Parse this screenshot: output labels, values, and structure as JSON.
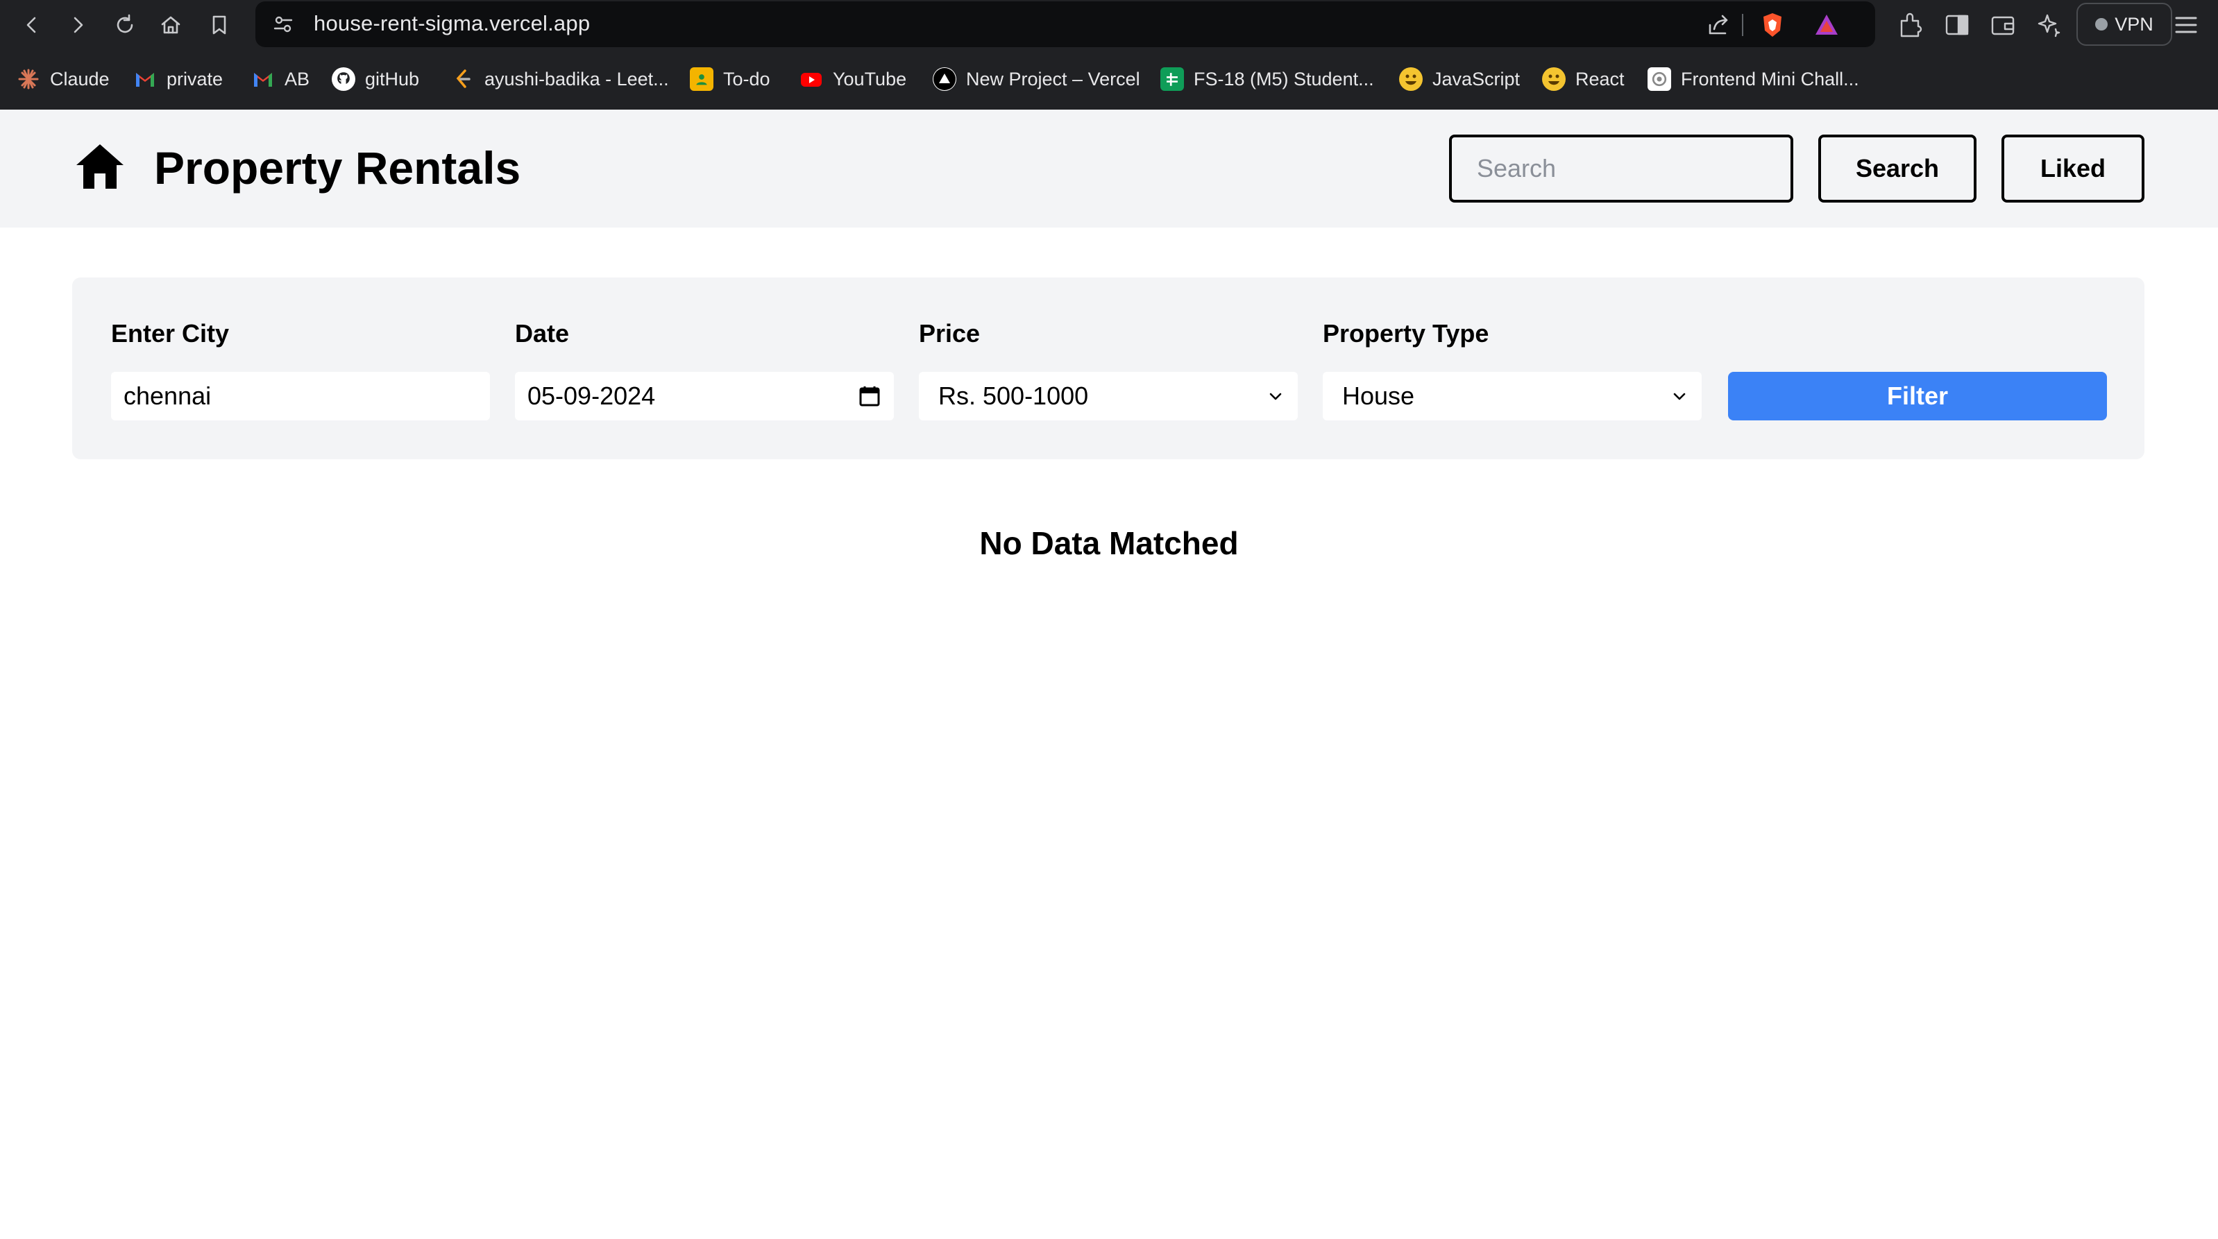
{
  "browser": {
    "url": "house-rent-sigma.vercel.app",
    "vpn_label": "VPN",
    "bookmarks": [
      {
        "label": "Claude",
        "icon": "claude-icon",
        "color": "#d97757"
      },
      {
        "label": "private",
        "icon": "gmail-icon",
        "color": "#ea4335"
      },
      {
        "label": "AB",
        "icon": "gmail-icon",
        "color": "#ea4335"
      },
      {
        "label": "gitHub",
        "icon": "github-icon",
        "color": "#ffffff"
      },
      {
        "label": "ayushi-badika - Leet...",
        "icon": "leetcode-icon",
        "color": "#f89f1b"
      },
      {
        "label": "To-do",
        "icon": "todo-icon",
        "color": "#f4b400"
      },
      {
        "label": "YouTube",
        "icon": "youtube-icon",
        "color": "#ff0000"
      },
      {
        "label": "New Project – Vercel",
        "icon": "vercel-icon",
        "color": "#000000"
      },
      {
        "label": "FS-18 (M5) Student...",
        "icon": "sheets-icon",
        "color": "#0f9d58"
      },
      {
        "label": "JavaScript",
        "icon": "emoji-icon",
        "color": "#f4c430"
      },
      {
        "label": "React",
        "icon": "emoji-icon",
        "color": "#f4c430"
      },
      {
        "label": "Frontend Mini Chall...",
        "icon": "frontend-icon",
        "color": "#ffffff"
      }
    ]
  },
  "header": {
    "title": "Property Rentals",
    "search_placeholder": "Search",
    "search_button": "Search",
    "liked_button": "Liked"
  },
  "filters": {
    "city_label": "Enter City",
    "city_value": "chennai",
    "date_label": "Date",
    "date_value": "05-09-2024",
    "price_label": "Price",
    "price_value": "Rs. 500-1000",
    "type_label": "Property Type",
    "type_value": "House",
    "filter_button": "Filter",
    "accent_color": "#3b82f6"
  },
  "results": {
    "message": "No Data Matched"
  }
}
